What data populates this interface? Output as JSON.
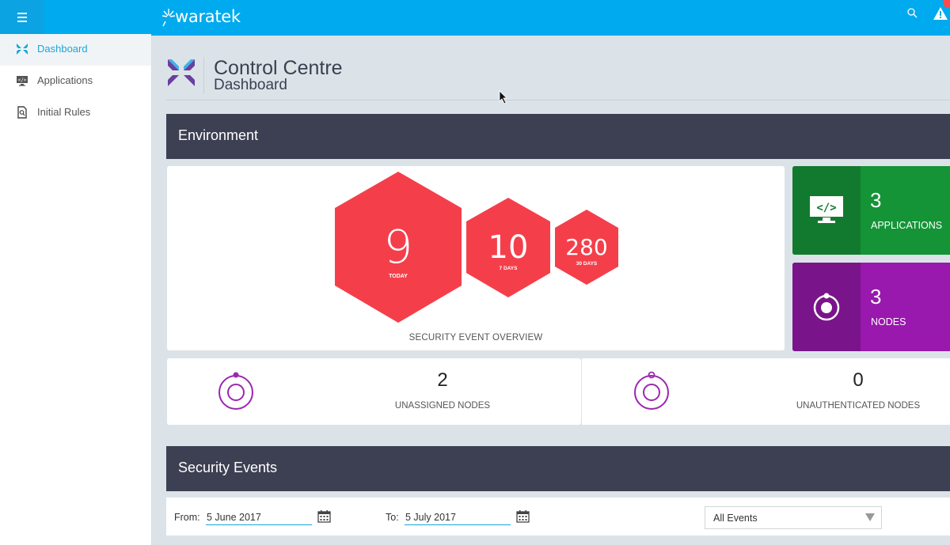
{
  "app": {
    "logo_text": "waratek"
  },
  "sidebar": {
    "items": [
      {
        "label": "Dashboard",
        "icon": "dashboard-arrows-icon",
        "active": true
      },
      {
        "label": "Applications",
        "icon": "monitor-code-icon",
        "active": false
      },
      {
        "label": "Initial Rules",
        "icon": "rules-document-icon",
        "active": false
      }
    ]
  },
  "header": {
    "title": "Control Centre",
    "subtitle": "Dashboard"
  },
  "environment": {
    "title": "Environment",
    "overview_label": "SECURITY EVENT OVERVIEW",
    "events": [
      {
        "value": "9",
        "label": "TODAY"
      },
      {
        "value": "10",
        "label": "7 DAYS"
      },
      {
        "value": "280",
        "label": "30 DAYS"
      }
    ],
    "applications": {
      "count": "3",
      "label": "APPLICATIONS"
    },
    "nodes": {
      "count": "3",
      "label": "NODES"
    },
    "unassigned": {
      "count": "2",
      "label": "UNASSIGNED NODES"
    },
    "unauthenticated": {
      "count": "0",
      "label": "UNAUTHENTICATED NODES"
    }
  },
  "security_events": {
    "title": "Security Events",
    "from_label": "From:",
    "from_value": "5 June 2017",
    "to_label": "To:",
    "to_value": "5 July 2017",
    "filter_value": "All Events"
  },
  "colors": {
    "topbar": "#00aaee",
    "accent": "#1aa6d9",
    "hexagon": "#f43f4b",
    "applications_dark": "#127a2e",
    "applications": "#149437",
    "nodes_dark": "#7a148a",
    "nodes": "#9918ad",
    "section_bar": "#3d4052",
    "node_ring": "#9b27b0"
  }
}
